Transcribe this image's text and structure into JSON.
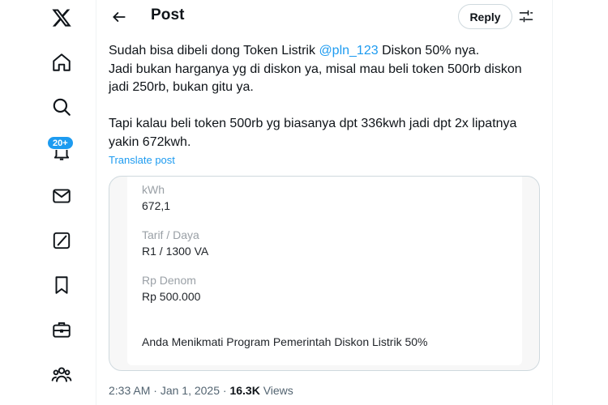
{
  "nav": {
    "items": [
      {
        "name": "x-logo-icon"
      },
      {
        "name": "home-icon"
      },
      {
        "name": "search-icon"
      },
      {
        "name": "notifications-icon"
      },
      {
        "name": "messages-icon"
      },
      {
        "name": "grok-icon"
      },
      {
        "name": "bookmarks-icon"
      },
      {
        "name": "jobs-icon"
      },
      {
        "name": "communities-icon"
      }
    ],
    "notifications_badge": "20+"
  },
  "header": {
    "title": "Post",
    "reply_label": "Reply"
  },
  "post": {
    "line1_pre": "Sudah bisa dibeli dong Token Listrik ",
    "mention": "@pln_123",
    "line1_post": " Diskon 50% nya.",
    "line2": "Jadi bukan harganya yg di diskon ya, misal mau beli token 500rb diskon",
    "line3": "jadi 250rb, bukan gitu ya.",
    "line4": "Tapi kalau beli token 500rb yg biasanya dpt 336kwh jadi dpt 2x lipatnya",
    "line5": "yakin 672kwh.",
    "translate": "Translate post"
  },
  "receipt": {
    "kwh_label": "kWh",
    "kwh_value": "672,1",
    "tarif_label": "Tarif / Daya",
    "tarif_value": "R1 / 1300 VA",
    "denom_label": "Rp Denom",
    "denom_value": "Rp 500.000",
    "note": "Anda Menikmati Program Pemerintah Diskon Listrik 50%"
  },
  "meta": {
    "time": "2:33 AM",
    "separator": " · ",
    "date": "Jan 1, 2025",
    "dot": " · ",
    "views_count": "16.3K",
    "views_label": " Views"
  },
  "colors": {
    "accent": "#1d9bf0",
    "text": "#0f1419",
    "muted": "#536471"
  }
}
